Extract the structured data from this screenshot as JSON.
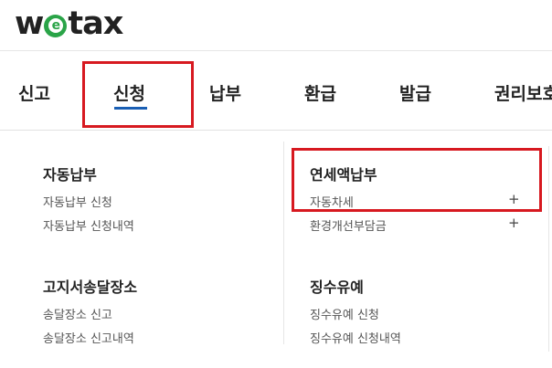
{
  "logo": {
    "pre": "w",
    "mid": "e",
    "post": "tax"
  },
  "nav": {
    "items": [
      "신고",
      "신청",
      "납부",
      "환급",
      "발급",
      "권리보호"
    ]
  },
  "menu": {
    "left": [
      {
        "title": "자동납부",
        "links": [
          "자동납부 신청",
          "자동납부 신청내역"
        ]
      },
      {
        "title": "고지서송달장소",
        "links": [
          "송달장소 신고",
          "송달장소 신고내역"
        ]
      }
    ],
    "right": [
      {
        "title": "연세액납부",
        "links": [
          "자동차세",
          "환경개선부담금"
        ],
        "expand_icon": "+"
      },
      {
        "title": "징수유예",
        "links": [
          "징수유예 신청",
          "징수유예 신청내역"
        ]
      }
    ]
  },
  "colors": {
    "highlight": "#d71920",
    "active_underline": "#1a5fb4",
    "logo_e": "#2aa448"
  }
}
